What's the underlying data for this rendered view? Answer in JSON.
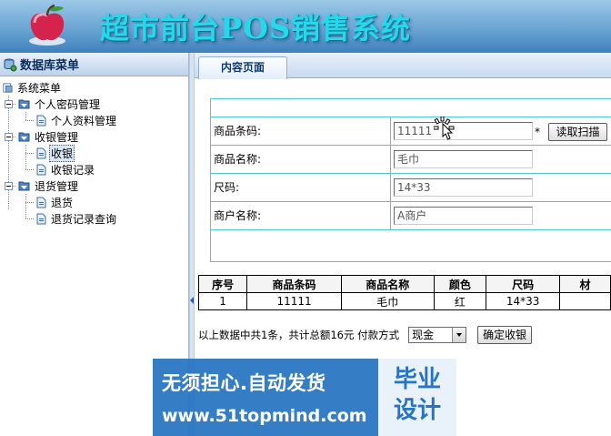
{
  "header": {
    "title": "超市前台POS销售系统"
  },
  "sidebar": {
    "title": "数据库菜单",
    "root": "系统菜单",
    "groups": [
      {
        "label": "个人密码管理",
        "items": [
          "个人资料管理"
        ]
      },
      {
        "label": "收银管理",
        "items": [
          "收银",
          "收银记录"
        ]
      },
      {
        "label": "退货管理",
        "items": [
          "退货",
          "退货记录查询"
        ]
      }
    ],
    "selected": "收银"
  },
  "tab": {
    "label": "内容页面"
  },
  "form": {
    "barcode_label": "商品条码:",
    "barcode_value": "11111",
    "required_mark": "*",
    "scan_button": "读取扫描",
    "name_label": "商品名称:",
    "name_value": "毛巾",
    "size_label": "尺码:",
    "size_value": "14*33",
    "merchant_label": "商户名称:",
    "merchant_value": "A商户"
  },
  "table": {
    "headers": [
      "序号",
      "商品条码",
      "商品名称",
      "颜色",
      "尺码",
      "材"
    ],
    "rows": [
      [
        "1",
        "11111",
        "毛巾",
        "红",
        "14*33",
        ""
      ]
    ]
  },
  "summary": {
    "text": "以上数据中共1条，共计总额16元 付款方式",
    "payment_selected": "现金",
    "confirm_button": "确定收银"
  },
  "watermark": {
    "line1": "无须担心.自动发货",
    "line2": "www.51topmind.com",
    "badge_line1": "毕业",
    "badge_line2": "设计"
  },
  "colors": {
    "header_gradient_top": "#9cc8e8",
    "header_gradient_bottom": "#3f80bd",
    "title_color": "#25d8ea",
    "form_border": "#53c6d6",
    "watermark_blue": "#2674c2"
  }
}
